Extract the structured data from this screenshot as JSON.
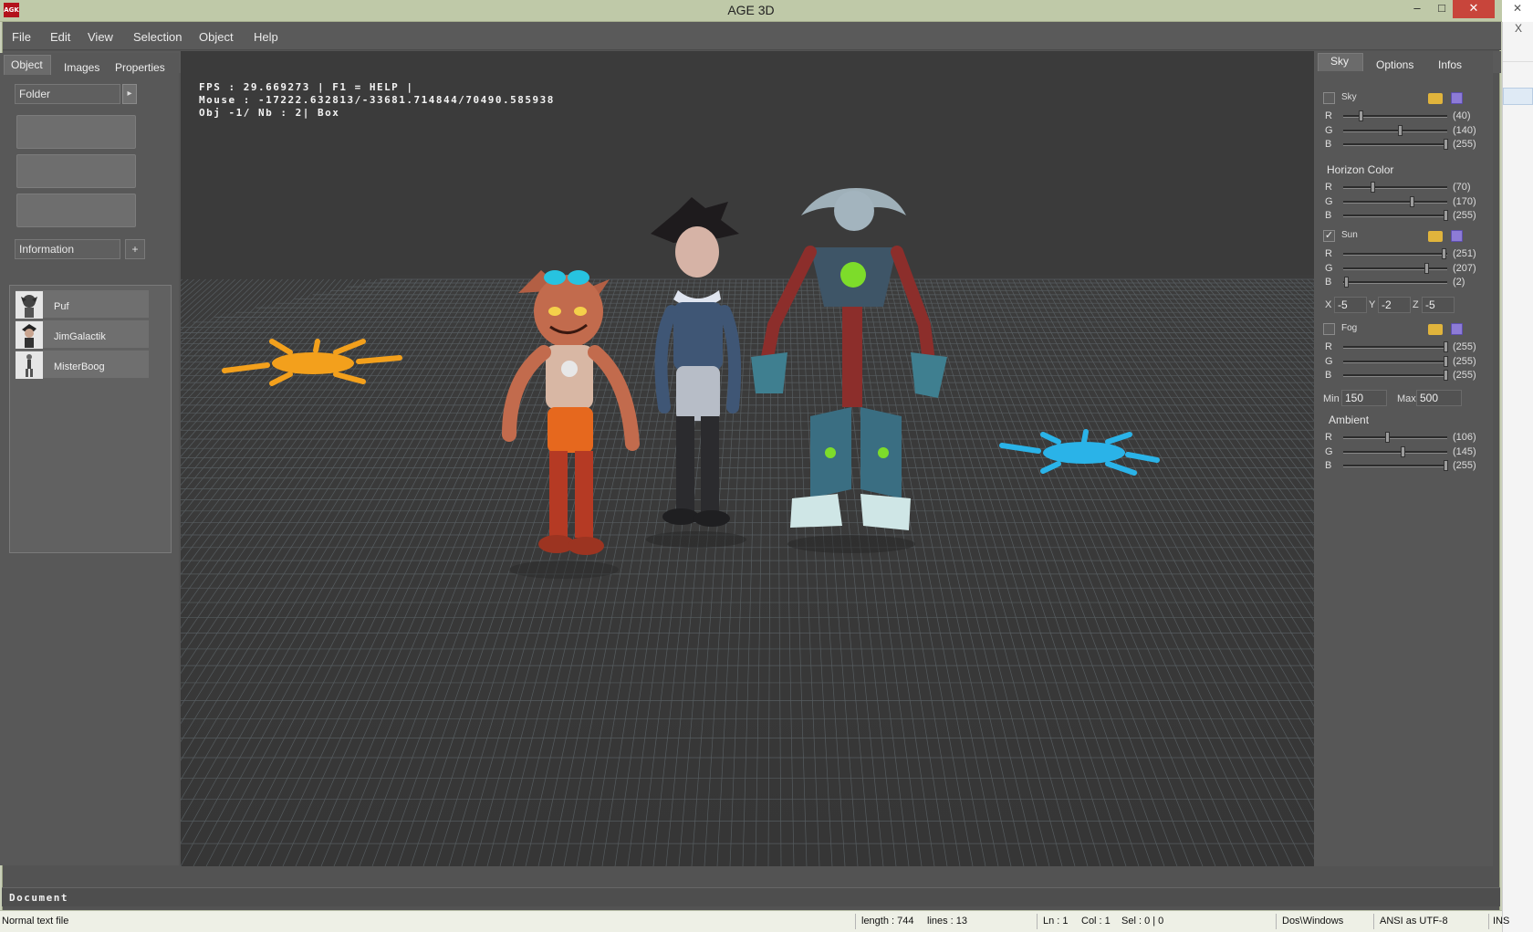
{
  "window": {
    "title": "AGE 3D",
    "app_icon_text": "AGK",
    "minimize": "–",
    "maximize": "□",
    "close": "✕"
  },
  "edge": {
    "close": "✕",
    "x": "X"
  },
  "menu": [
    "File",
    "Edit",
    "View",
    "Selection",
    "Object",
    "Help"
  ],
  "toolbar": [
    {
      "name": "new-icon",
      "glyph": "▯",
      "color": "#dfe8f5"
    },
    {
      "name": "open-icon",
      "glyph": "▰",
      "color": "#e1b640"
    },
    {
      "name": "save-icon",
      "glyph": "▣",
      "color": "#8e7fd8"
    },
    {
      "name": "terrain-icon",
      "glyph": "▲",
      "color": "#c0392b"
    },
    {
      "name": "light-icon",
      "glyph": "●",
      "color": "#f1d33a"
    },
    {
      "name": "camera-icon",
      "glyph": "◧",
      "color": "#cfcfcf"
    },
    {
      "name": "star-icon",
      "glyph": "★",
      "color": "#f3c614"
    },
    {
      "name": "play-icon",
      "glyph": "▶",
      "color": "#2f7fe0"
    },
    {
      "name": "add-icon",
      "glyph": "✚",
      "color": "#f08a12"
    },
    {
      "name": "select-icon",
      "glyph": "↖",
      "color": "#f08a12"
    },
    {
      "name": "move-icon",
      "glyph": "✥",
      "color": "#f0a012"
    },
    {
      "name": "rotate-icon",
      "glyph": "↻",
      "color": "#f0b512"
    },
    {
      "name": "scale-icon",
      "glyph": "◩",
      "color": "#e36f12"
    },
    {
      "name": "material-icon",
      "glyph": "▬",
      "color": "#c8a24a"
    },
    {
      "name": "delete-icon",
      "glyph": "✖",
      "color": "#e2241c"
    }
  ],
  "left": {
    "tabs": [
      "Object",
      "Images",
      "Properties"
    ],
    "folder": {
      "value": "Folder",
      "arrow": "▸"
    },
    "info": {
      "value": "Information",
      "plus": "+"
    },
    "objects": [
      {
        "label": "Puf"
      },
      {
        "label": "JimGalactik"
      },
      {
        "label": "MisterBoog"
      }
    ]
  },
  "osd": {
    "line1": "FPS : 29.669273 | F1 = HELP |",
    "line2": "Mouse : -17222.632813/-33681.714844/70490.585938",
    "line3": "Obj -1/ Nb : 2| Box"
  },
  "right": {
    "tabs": [
      "Sky",
      "Options",
      "Infos"
    ],
    "sky": {
      "label": "Sky",
      "checked": false,
      "r": "(40)",
      "g": "(140)",
      "b": "(255)",
      "rv": 40,
      "gv": 140,
      "bv": 255
    },
    "horizon": {
      "label": "Horizon  Color",
      "r": "(70)",
      "g": "(170)",
      "b": "(255)",
      "rv": 70,
      "gv": 170,
      "bv": 255
    },
    "sun": {
      "label": "Sun",
      "checked": true,
      "r": "(251)",
      "g": "(207)",
      "b": "(2)",
      "rv": 251,
      "gv": 207,
      "bv": 2
    },
    "position": {
      "x_label": "X",
      "x": "-5",
      "y_label": "Y",
      "y": "-2",
      "z_label": "Z",
      "z": "-5"
    },
    "fog": {
      "label": "Fog",
      "checked": false,
      "r": "(255)",
      "g": "(255)",
      "b": "(255)",
      "rv": 255,
      "gv": 255,
      "bv": 255
    },
    "fog_range": {
      "min_label": "Min",
      "min": "150",
      "max_label": "Max",
      "max": "500"
    },
    "ambient": {
      "label": "Ambient",
      "r": "(106)",
      "g": "(145)",
      "b": "(255)",
      "rv": 106,
      "gv": 145,
      "bv": 255
    },
    "channels": [
      "R",
      "G",
      "B"
    ]
  },
  "doc_label": "Document",
  "status": {
    "type": "Normal text file",
    "length": "length : 744",
    "lines": "lines : 13",
    "ln": "Ln : 1",
    "col": "Col : 1",
    "sel": "Sel : 0 | 0",
    "eol": "Dos\\Windows",
    "encoding": "ANSI as UTF-8",
    "mode": "INS"
  }
}
